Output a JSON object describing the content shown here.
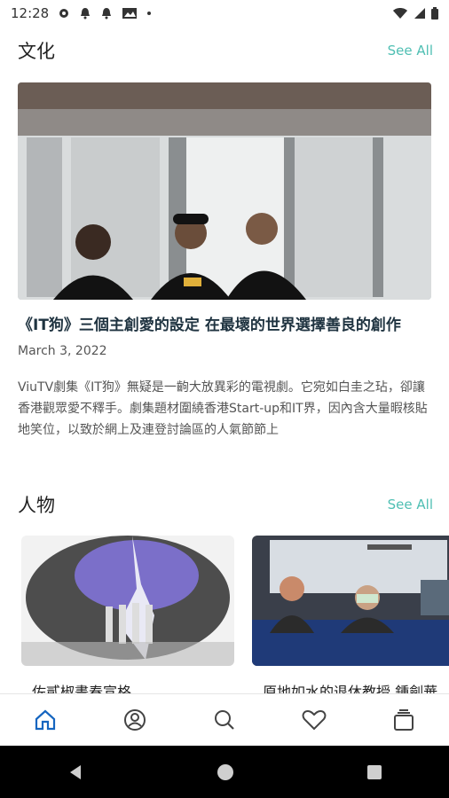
{
  "status": {
    "time": "12:28"
  },
  "section1": {
    "title": "文化",
    "see_all": "See All"
  },
  "featured": {
    "title": "《IT狗》三個主創愛的設定 在最壞的世界選擇善良的創作",
    "date": "March 3, 2022",
    "excerpt": "ViuTV劇集《IT狗》無疑是一齣大放異彩的電視劇。它宛如白圭之玷，卻讓香港觀眾愛不釋手。劇集題材圍繞香港Start-up和IT界，因內含大量暇核貼地笑位，以致於網上及連登討論區的人氣節節上"
  },
  "section2": {
    "title": "人物",
    "see_all": "See All"
  },
  "cards": [
    {
      "title": "佐貳椒畫春宣格"
    },
    {
      "title": "原地如水的退休教授 鍾劍華"
    }
  ],
  "bottom_nav": [
    "home-icon",
    "profile-icon",
    "search-icon",
    "heart-icon",
    "collections-icon"
  ],
  "colors": {
    "accent": "#4fbfb3",
    "nav_active": "#1565c0"
  }
}
